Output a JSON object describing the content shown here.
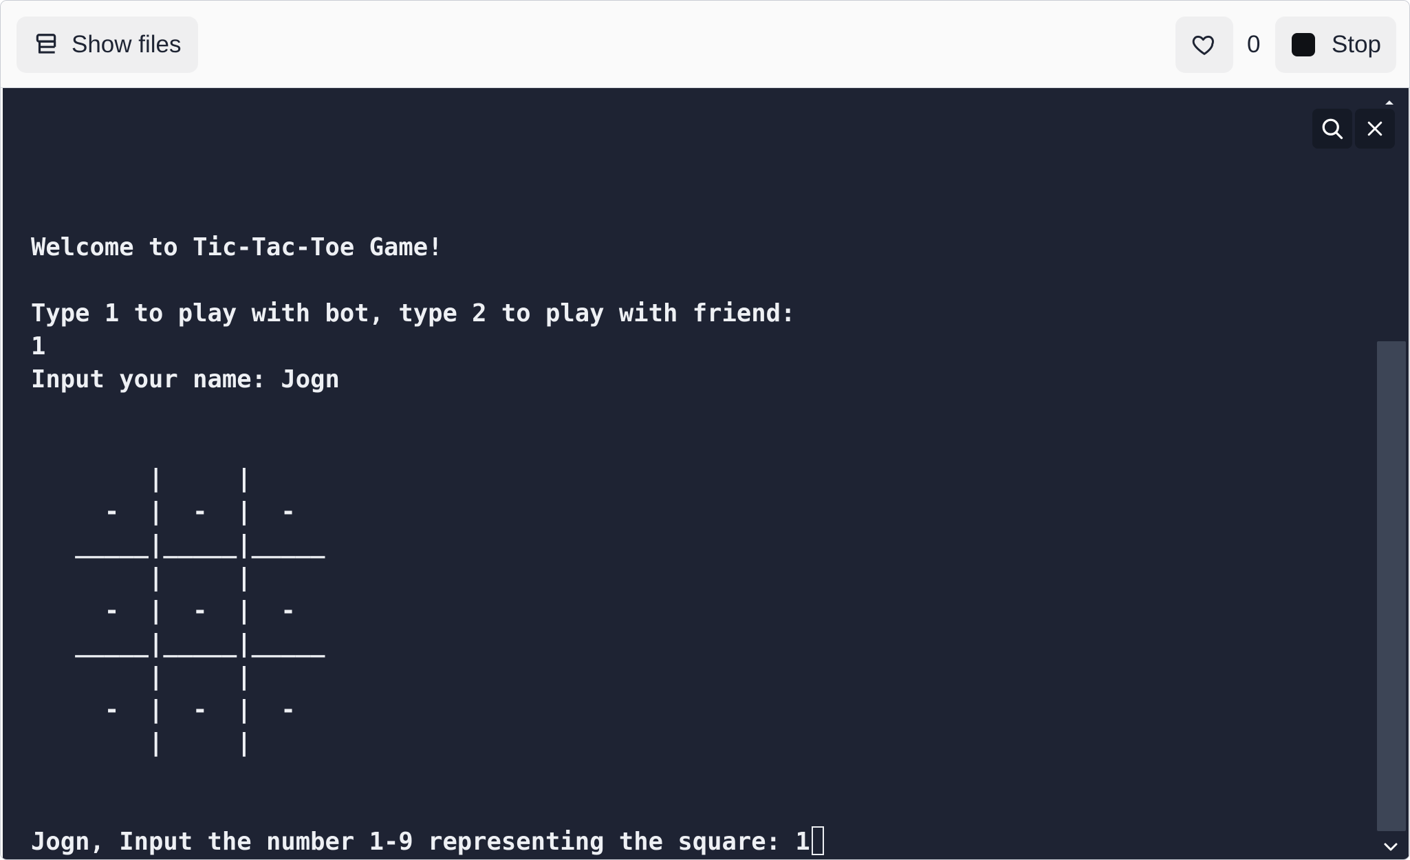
{
  "toolbar": {
    "show_files_label": "Show files",
    "show_files_icon": "database-stack-icon",
    "like_icon": "heart-icon",
    "like_count": "0",
    "stop_label": "Stop",
    "stop_icon": "stop-square-icon"
  },
  "console": {
    "lines": [
      "Welcome to Tic-Tac-Toe Game!",
      "",
      "Type 1 to play with bot, type 2 to play with friend:",
      "1",
      "Input your name: Jogn",
      "",
      "",
      "        |     |",
      "     -  |  -  |  -",
      "   _____|_____|_____",
      "        |     |",
      "     -  |  -  |  -",
      "   _____|_____|_____",
      "        |     |",
      "     -  |  -  |  -",
      "        |     |"
    ],
    "prompt": "Jogn, Input the number 1-9 representing the square: 1",
    "search_icon": "search-icon",
    "close_icon": "close-icon"
  },
  "colors": {
    "console_bg": "#1e2333",
    "console_text": "#eef0f4",
    "toolbar_bg": "#fafafa",
    "button_bg": "#efeff0"
  }
}
